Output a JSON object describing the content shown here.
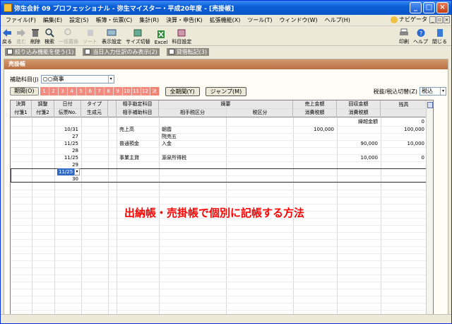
{
  "window": {
    "title": "弥生会計 09 プロフェッショナル - 弥生マイスター・平成20年度 - [売掛帳]"
  },
  "menu": [
    "ファイル(F)",
    "編集(E)",
    "設定(S)",
    "帳簿・伝票(C)",
    "集計(R)",
    "決算・申告(K)",
    "拡張機能(X)",
    "ツール(T)",
    "ウィンドウ(W)",
    "ヘルプ(H)"
  ],
  "navi_label": "ナビゲータ",
  "toolbar": {
    "left": [
      {
        "label": "戻る",
        "icon": "back-icon",
        "enabled": true
      },
      {
        "label": "進む",
        "icon": "forward-icon",
        "enabled": false
      },
      {
        "label": "削除",
        "icon": "delete-icon",
        "enabled": true
      },
      {
        "label": "検索",
        "icon": "search-icon",
        "enabled": true
      },
      {
        "label": "一括置換",
        "icon": "replace-icon",
        "enabled": false
      },
      {
        "label": "ソート",
        "icon": "sort-icon",
        "enabled": false
      },
      {
        "label": "表示設定",
        "icon": "display-settings-icon",
        "enabled": true
      },
      {
        "label": "サイズ切替",
        "icon": "size-toggle-icon",
        "enabled": true
      },
      {
        "label": "Excel",
        "icon": "excel-icon",
        "enabled": true
      },
      {
        "label": "科目設定",
        "icon": "account-settings-icon",
        "enabled": true
      }
    ],
    "right": [
      {
        "label": "印刷",
        "icon": "print-icon"
      },
      {
        "label": "ヘルプ",
        "icon": "help-icon"
      },
      {
        "label": "閉じる",
        "icon": "close-door-icon"
      }
    ]
  },
  "options": [
    "絞り込み機能を使う(1)",
    "当日入力仕訳のみ表示(2)",
    "貸借転記(3)"
  ],
  "panel_title": "売掛帳",
  "sub_account": {
    "label": "補助科目(J)",
    "value": "○○商事"
  },
  "period": {
    "label": "期間(O)",
    "months": [
      "1",
      "2",
      "3",
      "4",
      "5",
      "6",
      "7",
      "8",
      "9",
      "10",
      "11",
      "12",
      "決"
    ],
    "all_label": "全期間(Y)",
    "jump_label": "ジャンプ(M)"
  },
  "tax": {
    "label": "税抜/税込切替(Z)",
    "value": "税込"
  },
  "columns": {
    "c1": [
      "決算",
      "付箋1"
    ],
    "c2": [
      "調整",
      "付箋2"
    ],
    "c3": [
      "日付",
      "伝票No."
    ],
    "c4": [
      "タイプ",
      "生成元"
    ],
    "c5": [
      "相手勘定科目",
      "相手補助科目"
    ],
    "c6_top": "摘要",
    "c6a": "相手税区分",
    "c6b": "税区分",
    "c7": [
      "売上金額",
      "消費税額"
    ],
    "c8": [
      "回収金額",
      "消費税額"
    ],
    "c9": "残高",
    "c10": "繰越金額"
  },
  "carry_over": "0",
  "rows": [
    {
      "date": "10/31",
      "no": "27",
      "account": "売上高",
      "memo": "朝霞",
      "memo2": "院売五",
      "sales": "100,000",
      "recv": "",
      "bal": "100,000"
    },
    {
      "date": "11/25",
      "no": "28",
      "account": "普通預金",
      "memo": "入金",
      "memo2": "",
      "sales": "",
      "recv": "90,000",
      "bal": "10,000"
    },
    {
      "date": "11/25",
      "no": "29",
      "account": "事業主貸",
      "memo": "源泉所得税",
      "memo2": "",
      "sales": "",
      "recv": "10,000",
      "bal": "0"
    }
  ],
  "new_row": {
    "date": "11/25",
    "no": "30"
  },
  "overlay_text": "出納帳・売掛帳で個別に記帳する方法"
}
